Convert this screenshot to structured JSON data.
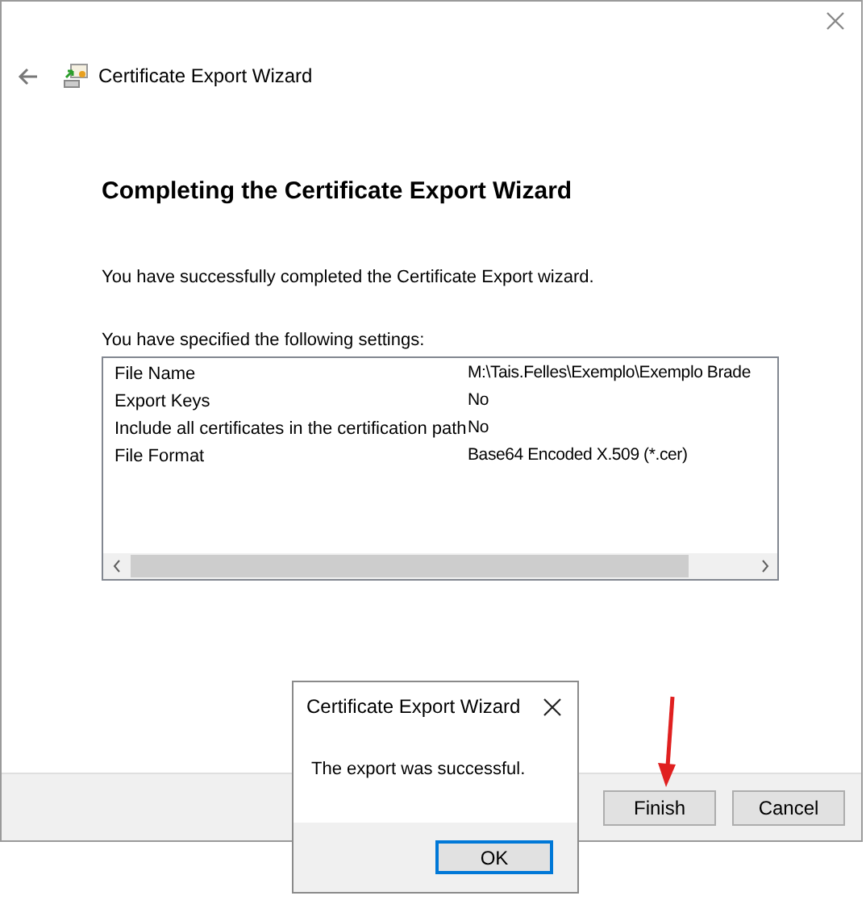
{
  "window": {
    "title": "Certificate Export Wizard"
  },
  "heading": "Completing the Certificate Export Wizard",
  "message": "You have successfully completed the Certificate Export wizard.",
  "settings_label": "You have specified the following settings:",
  "settings": [
    {
      "name": "File Name",
      "value": "M:\\Tais.Felles\\Exemplo\\Exemplo Brade"
    },
    {
      "name": "Export Keys",
      "value": "No"
    },
    {
      "name": "Include all certificates in the certification path",
      "value": "No"
    },
    {
      "name": "File Format",
      "value": "Base64 Encoded X.509 (*.cer)"
    }
  ],
  "buttons": [
    "Finish",
    "Cancel"
  ],
  "dialog": {
    "title": "Certificate Export Wizard",
    "message": "The export was successful.",
    "button": "OK"
  }
}
